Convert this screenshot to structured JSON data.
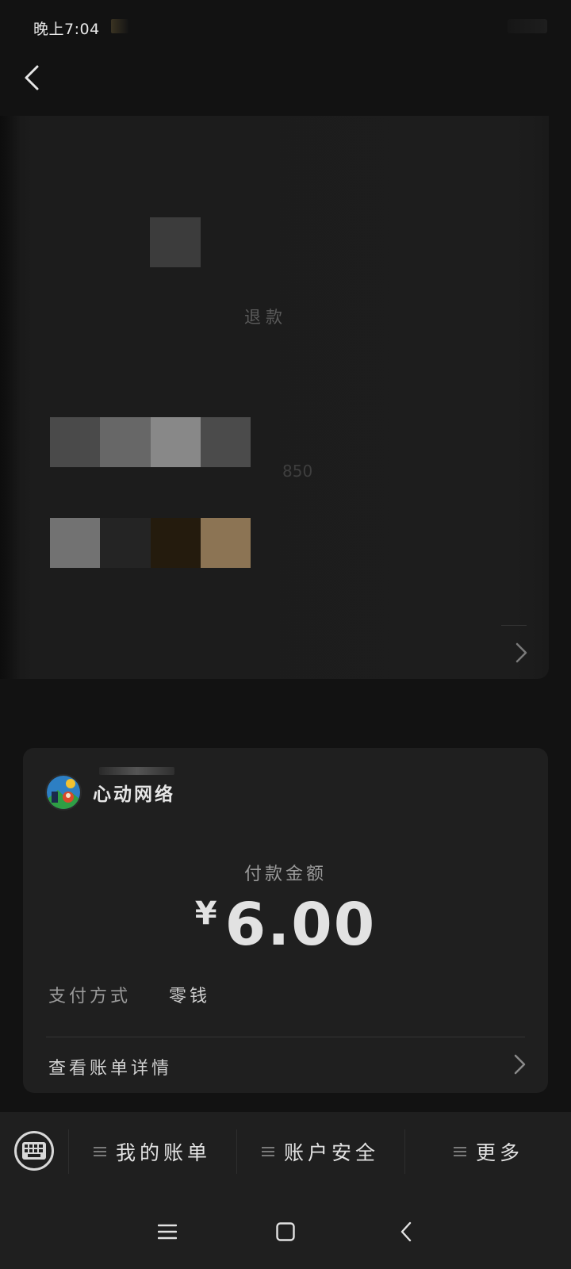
{
  "status_bar": {
    "time": "晚上7:04"
  },
  "top_card": {
    "refund_label": "退款",
    "faint_digits": "850",
    "mosaic_row_1": [
      "#4a4a4a",
      "#676767",
      "#888888",
      "#4b4b4b"
    ],
    "mosaic_row_2": [
      "#727272",
      "#242424",
      "#241b0d",
      "#8c7454"
    ]
  },
  "payment": {
    "merchant_name": "心动网络",
    "amount_label": "付款金额",
    "currency_symbol": "¥",
    "amount": "6.00",
    "method_label": "支付方式",
    "method_value": "零钱",
    "bill_detail_label": "查看账单详情"
  },
  "bottom_menu": {
    "items": [
      {
        "label": "我的账单"
      },
      {
        "label": "账户安全"
      },
      {
        "label": "更多"
      }
    ]
  },
  "icons": {
    "back": "back-arrow-icon",
    "keyboard": "keyboard-icon",
    "chevron": "chevron-right-icon",
    "menu_lines": "menu-lines-icon",
    "nav_recents": "nav-recents-icon",
    "nav_home": "nav-home-icon",
    "nav_back": "nav-back-icon"
  },
  "colors": {
    "background": "#121212",
    "card": "#1f1f1f",
    "text_primary": "#e2e2e2",
    "text_secondary": "#9a9a9a"
  }
}
